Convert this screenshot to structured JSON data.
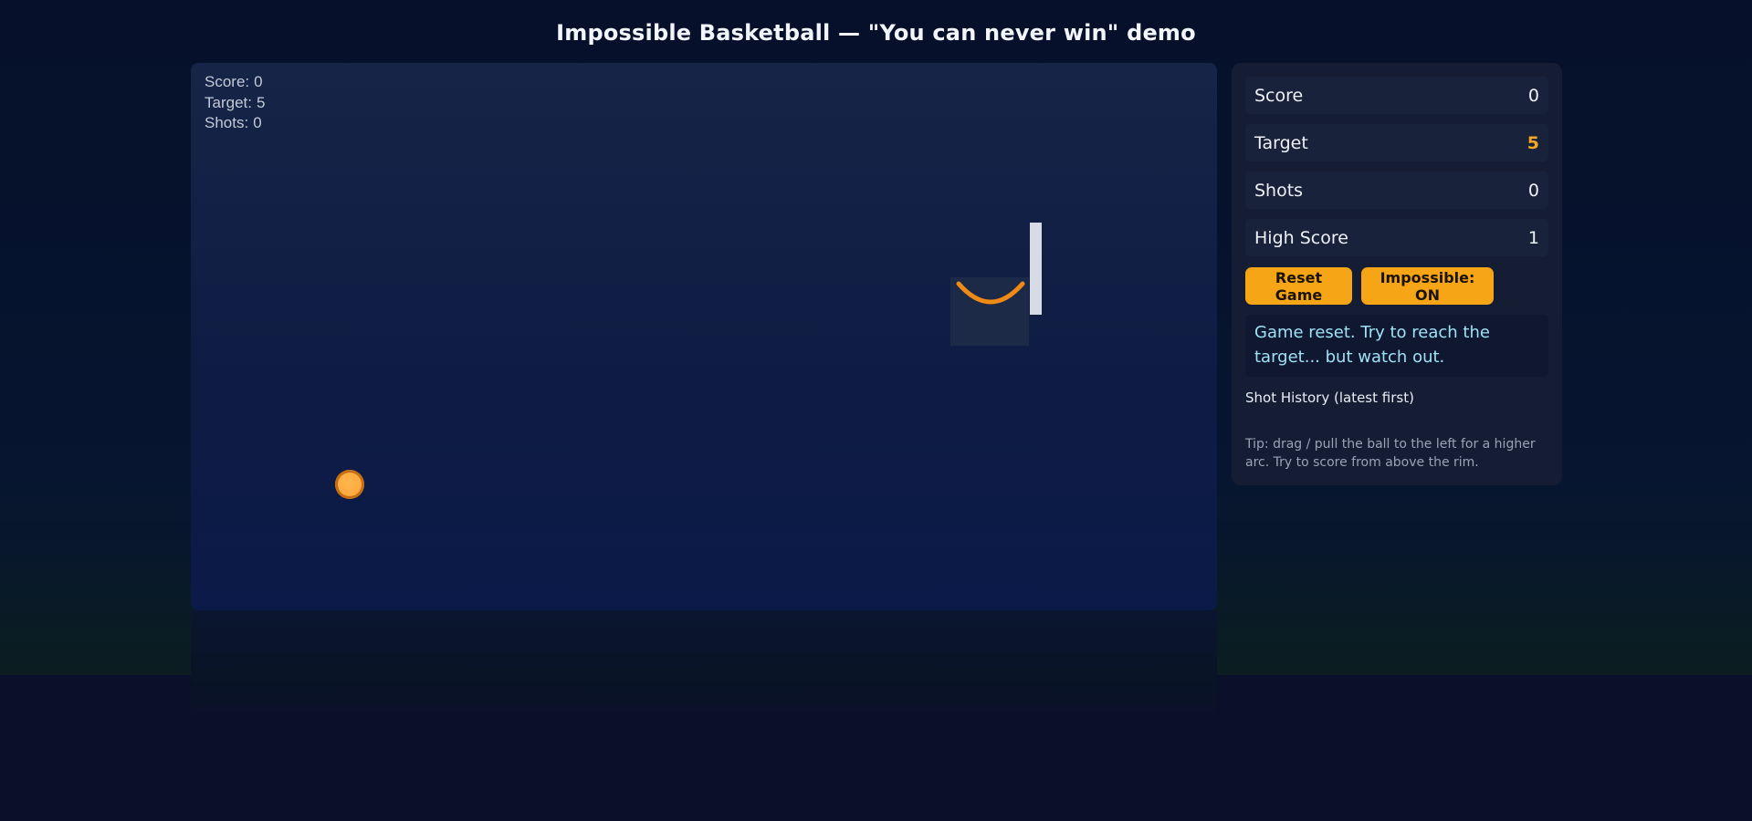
{
  "title": "Impossible Basketball — \"You can never win\" demo",
  "hud": {
    "score_label": "Score:",
    "score_value": "0",
    "target_label": "Target:",
    "target_value": "5",
    "shots_label": "Shots:",
    "shots_value": "0"
  },
  "stats": [
    {
      "label": "Score",
      "value": "0"
    },
    {
      "label": "Target",
      "value": "5"
    },
    {
      "label": "Shots",
      "value": "0"
    },
    {
      "label": "High Score",
      "value": "1"
    }
  ],
  "buttons": {
    "reset_label": "Reset Game",
    "impossible_label": "Impossible: ON"
  },
  "message": "Game reset. Try to reach the target... but watch out.",
  "history_title": "Shot History (latest first)",
  "tip": "Tip: drag / pull the ball to the left for a higher arc. Try to score from above the rim.",
  "colors": {
    "accent": "#f5a516",
    "rim": "#f08a14",
    "message_text": "#9fe1f5"
  }
}
